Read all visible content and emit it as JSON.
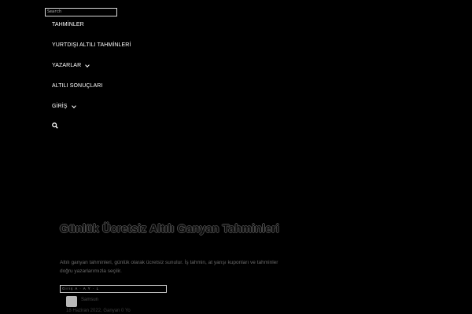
{
  "search": {
    "placeholder": "Search"
  },
  "nav": {
    "items": [
      {
        "label": "TAHMİNLER",
        "has_dropdown": false
      },
      {
        "label": "YURTDIŞI ALTILI TAHMİNLERİ",
        "has_dropdown": false
      },
      {
        "label": "YAZARLAR",
        "has_dropdown": true
      },
      {
        "label": "ALTILI SONUÇLARI",
        "has_dropdown": false
      },
      {
        "label": "GİRİŞ",
        "has_dropdown": true
      }
    ],
    "search_icon": "search-icon"
  },
  "hero": {
    "title": "Günlük Ücretsiz Altılı Ganyan Tahminleri",
    "description": "Altılı ganyan tahminleri, günlük olarak ücretsiz sunulur. İş tahmin, at yarışı kuponları ve tahminler doğru yazarlarımızla seçilir."
  },
  "breadcrumb": {
    "text": "Giriş   A  ·  A  Y  ·  L"
  },
  "post": {
    "author": "Samsun",
    "meta": "18 Haziran 2022, Ganyan   0   Yo"
  },
  "colors": {
    "background": "#000000",
    "text": "#ffffff"
  }
}
